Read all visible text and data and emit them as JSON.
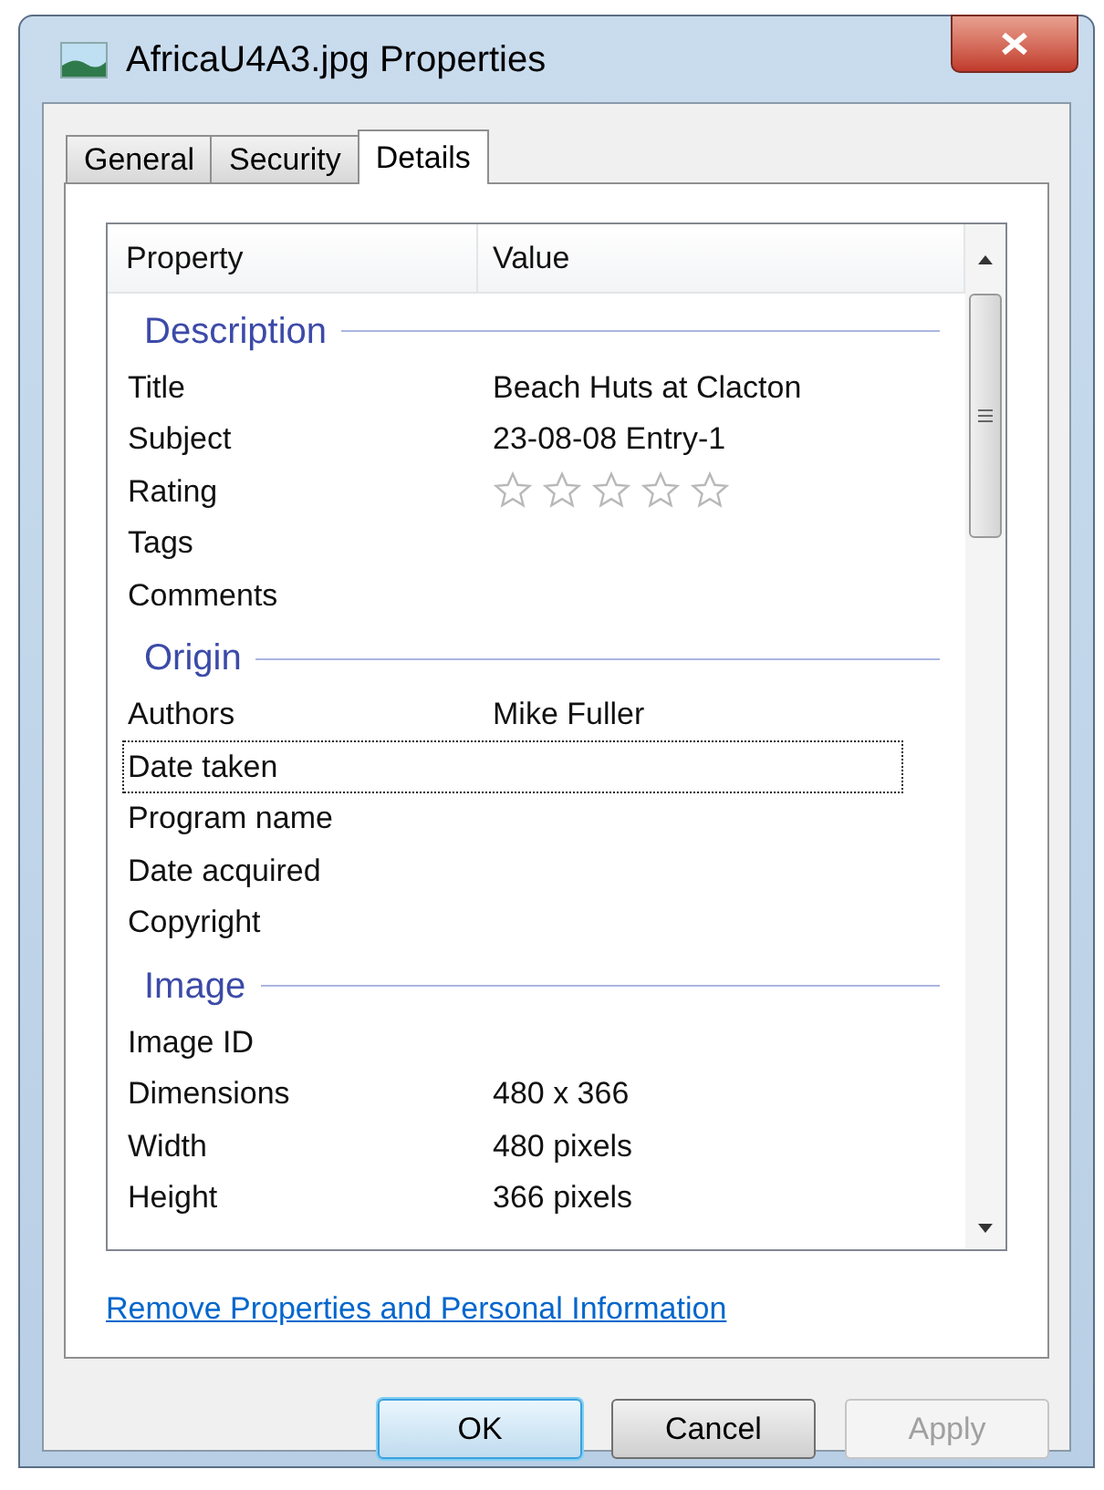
{
  "window": {
    "title": "AfricaU4A3.jpg Properties"
  },
  "tabs": [
    {
      "label": "General",
      "selected": false
    },
    {
      "label": "Security",
      "selected": false
    },
    {
      "label": "Details",
      "selected": true
    }
  ],
  "table": {
    "columns": [
      "Property",
      "Value"
    ],
    "rows": [
      {
        "kind": "group",
        "label": "Description"
      },
      {
        "kind": "property",
        "name": "Title",
        "value": "Beach Huts at Clacton",
        "selected": false
      },
      {
        "kind": "property",
        "name": "Subject",
        "value": "23-08-08 Entry-1",
        "selected": false
      },
      {
        "kind": "rating",
        "name": "Rating",
        "stars": 0,
        "selected": false
      },
      {
        "kind": "property",
        "name": "Tags",
        "selected": false
      },
      {
        "kind": "property",
        "name": "Comments",
        "selected": false
      },
      {
        "kind": "group",
        "label": "Origin"
      },
      {
        "kind": "property",
        "name": "Authors",
        "value": "Mike Fuller",
        "selected": false
      },
      {
        "kind": "property",
        "name": "Date taken",
        "selected": true
      },
      {
        "kind": "property",
        "name": "Program name",
        "selected": false
      },
      {
        "kind": "property",
        "name": "Date acquired",
        "selected": false
      },
      {
        "kind": "property",
        "name": "Copyright",
        "selected": false
      },
      {
        "kind": "group",
        "label": "Image"
      },
      {
        "kind": "property",
        "name": "Image ID",
        "selected": false
      },
      {
        "kind": "property",
        "name": "Dimensions",
        "value": "480 x 366",
        "selected": false
      },
      {
        "kind": "property",
        "name": "Width",
        "value": "480 pixels",
        "selected": false
      },
      {
        "kind": "property",
        "name": "Height",
        "value": "366 pixels",
        "selected": false
      }
    ]
  },
  "link": "Remove Properties and Personal Information",
  "buttons": [
    {
      "label": "OK",
      "default": true,
      "disabled": false
    },
    {
      "label": "Cancel",
      "default": false,
      "disabled": false
    },
    {
      "label": "Apply",
      "default": false,
      "disabled": true
    }
  ]
}
